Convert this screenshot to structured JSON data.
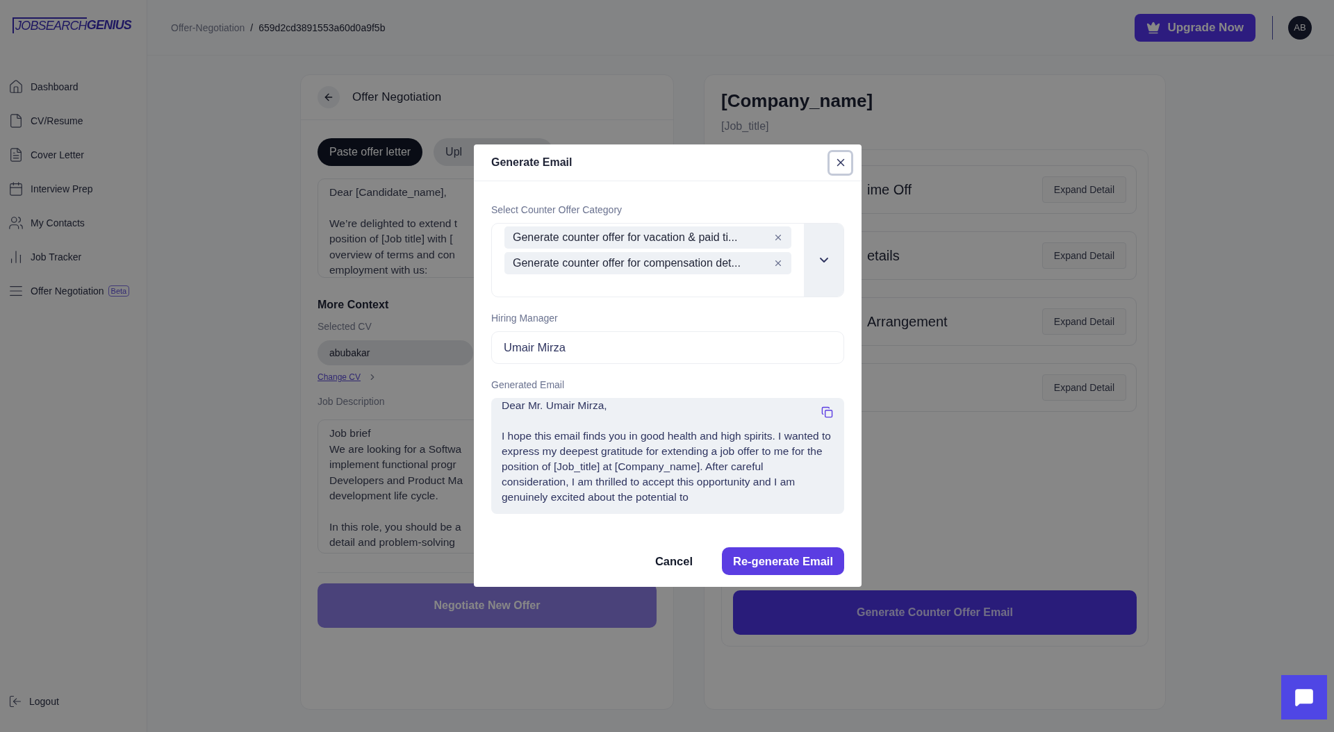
{
  "sidebar": {
    "logo": {
      "light": "JOBSEARCH",
      "bold": "GENIUS"
    },
    "items": [
      {
        "label": "Dashboard"
      },
      {
        "label": "CV/Resume"
      },
      {
        "label": "Cover Letter"
      },
      {
        "label": "Interview Prep"
      },
      {
        "label": "My Contacts"
      },
      {
        "label": "Job Tracker"
      },
      {
        "label": "Offer Negotiation",
        "badge": "Beta"
      }
    ],
    "logout": "Logout"
  },
  "header": {
    "breadcrumb": [
      "Offer-Negotiation",
      "659d2cd3891553a60d0a9f5b"
    ],
    "separator": "/",
    "upgrade": "Upgrade Now",
    "avatar": "AB"
  },
  "left_panel": {
    "title": "Offer Negotiation",
    "tabs": [
      {
        "label": "Paste offer letter",
        "selected": true
      },
      {
        "label": "Upl",
        "selected": false
      }
    ],
    "letter": [
      [
        "Dear [Candidate_name],"
      ],
      [
        "We’re delighted to extend t",
        "position of [Job title] with [",
        "overview of terms and con",
        "employment with us:"
      ]
    ],
    "more_context": "More Context",
    "selected_cv_label": "Selected CV",
    "selected_cv": "abubakar",
    "change_cv": "Change CV",
    "job_description_label": "Job Description",
    "job_description": [
      [
        "Job brief",
        "We are looking for a Softwa",
        "implement functional progr",
        "Developers and Product Ma",
        "development life cycle."
      ],
      [
        "In this role, you should be a",
        "detail and problem-solving"
      ]
    ],
    "submit": "Negotiate New Offer"
  },
  "right_panel": {
    "company": "[Company_name]",
    "job_title": "[Job_title]",
    "sections": [
      {
        "title": "ime Off",
        "action": "Expand Detail"
      },
      {
        "title": "etails",
        "action": "Expand Detail"
      },
      {
        "title": "Arrangement",
        "action": "Expand Detail"
      },
      {
        "action": "Expand Detail"
      }
    ],
    "generate": "Generate Counter Offer Email"
  },
  "modal": {
    "title": "Generate Email",
    "category_label": "Select Counter Offer Category",
    "categories": [
      "Generate counter offer for vacation & paid ti...",
      "Generate counter offer for compensation det..."
    ],
    "hiring_manager_label": "Hiring Manager",
    "hiring_manager": "Umair Mirza",
    "email_label": "Generated Email",
    "email": [
      "Dear Mr. Umair Mirza,",
      "I hope this email finds you in good health and high spirits. I wanted to express my deepest gratitude for extending a job offer to me for the position of [Job_title] at [Company_name]. After careful consideration, I am thrilled to accept this opportunity and I am genuinely excited about the potential to"
    ],
    "cancel": "Cancel",
    "regenerate": "Re-generate Email"
  }
}
